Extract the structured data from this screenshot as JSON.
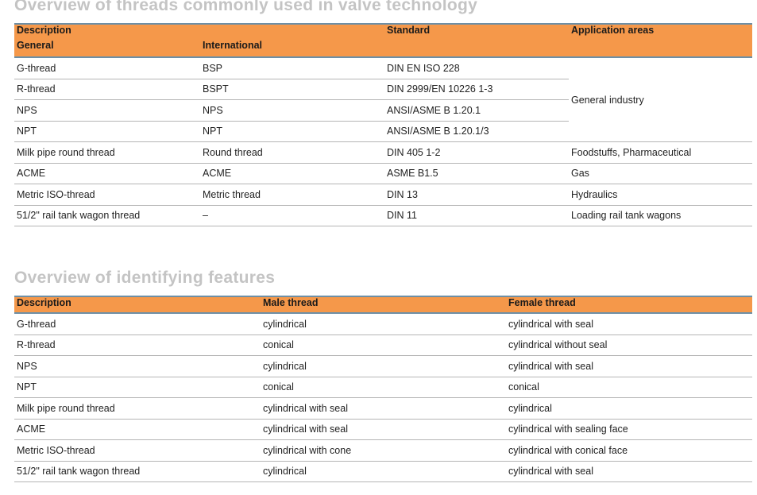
{
  "table1": {
    "title": "Overview of threads commonly used in valve technology",
    "header": {
      "description": "Description",
      "general": "General",
      "international": "International",
      "standard": "Standard",
      "application": "Application areas"
    },
    "rows": [
      {
        "general": "G-thread",
        "international": "BSP",
        "standard": "DIN EN ISO 228",
        "application": "General industry"
      },
      {
        "general": "R-thread",
        "international": "BSPT",
        "standard": "DIN 2999/EN 10226 1-3"
      },
      {
        "general": "NPS",
        "international": "NPS",
        "standard": "ANSI/ASME B 1.20.1"
      },
      {
        "general": "NPT",
        "international": "NPT",
        "standard": "ANSI/ASME B 1.20.1/3"
      },
      {
        "general": "Milk pipe round thread",
        "international": "Round thread",
        "standard": "DIN 405 1-2",
        "application": "Foodstuffs, Pharmaceutical"
      },
      {
        "general": "ACME",
        "international": "ACME",
        "standard": "ASME B1.5",
        "application": "Gas"
      },
      {
        "general": "Metric ISO-thread",
        "international": "Metric thread",
        "standard": "DIN 13",
        "application": "Hydraulics"
      },
      {
        "general": "51/2\" rail tank wagon thread",
        "international": "–",
        "standard": "DIN 11",
        "application": "Loading rail tank wagons"
      }
    ]
  },
  "table2": {
    "title": "Overview of identifying features",
    "header": {
      "description": "Description",
      "male": "Male thread",
      "female": "Female thread"
    },
    "rows": [
      {
        "description": "G-thread",
        "male": "cylindrical",
        "female": "cylindrical with seal"
      },
      {
        "description": "R-thread",
        "male": "conical",
        "female": "cylindrical without seal"
      },
      {
        "description": "NPS",
        "male": "cylindrical",
        "female": "cylindrical with seal"
      },
      {
        "description": "NPT",
        "male": "conical",
        "female": "conical"
      },
      {
        "description": "Milk pipe round thread",
        "male": "cylindrical with seal",
        "female": "cylindrical"
      },
      {
        "description": "ACME",
        "male": "cylindrical with seal",
        "female": "cylindrical with sealing face"
      },
      {
        "description": "Metric ISO-thread",
        "male": "cylindrical with cone",
        "female": "cylindrical with conical face"
      },
      {
        "description": "51/2\" rail tank wagon thread",
        "male": "cylindrical",
        "female": "cylindrical with seal"
      }
    ]
  },
  "colors": {
    "header": "#f5984a",
    "title": "#c4c4c4",
    "header_rule": "#6d8fa6"
  }
}
